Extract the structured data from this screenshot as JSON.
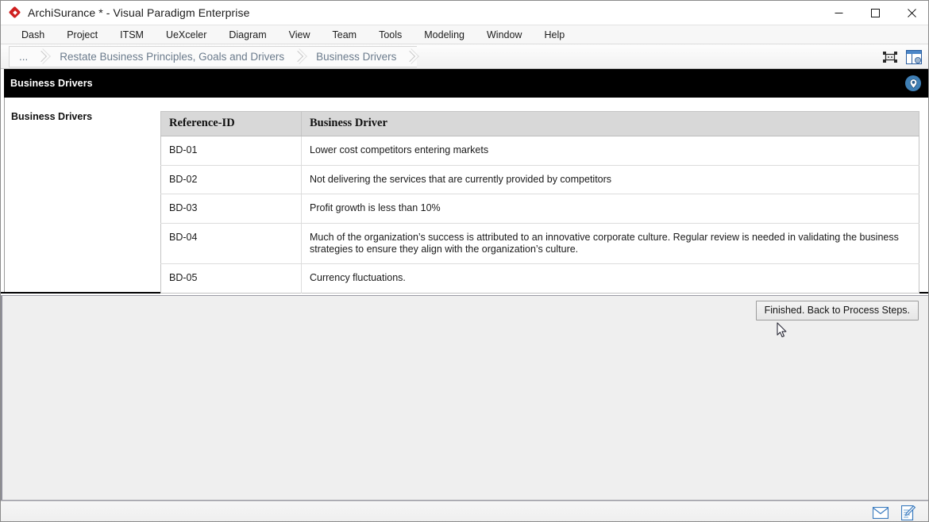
{
  "window": {
    "title": "ArchiSurance * - Visual Paradigm Enterprise",
    "logo_icon": "red-diamond-logo",
    "controls": {
      "minimize_label": "Minimize",
      "maximize_label": "Maximize",
      "close_label": "Close"
    }
  },
  "menubar": {
    "items": [
      {
        "label": "Dash"
      },
      {
        "label": "Project"
      },
      {
        "label": "ITSM"
      },
      {
        "label": "UeXceler"
      },
      {
        "label": "Diagram"
      },
      {
        "label": "View"
      },
      {
        "label": "Team"
      },
      {
        "label": "Tools"
      },
      {
        "label": "Modeling"
      },
      {
        "label": "Window"
      },
      {
        "label": "Help"
      }
    ]
  },
  "breadcrumb": {
    "items": [
      {
        "label": "..."
      },
      {
        "label": "Restate Business Principles, Goals and Drivers"
      },
      {
        "label": "Business Drivers"
      }
    ],
    "tools": [
      {
        "icon": "fit-to-screen-icon"
      },
      {
        "icon": "panel-layout-icon"
      }
    ]
  },
  "section": {
    "title": "Business Drivers",
    "badge_icon": "location-pin-icon",
    "badge_color": "#3f7fb5"
  },
  "sidebar": {
    "label": "Business Drivers"
  },
  "table": {
    "columns": [
      {
        "key": "ref",
        "label": "Reference-ID"
      },
      {
        "key": "driver",
        "label": "Business Driver"
      }
    ],
    "rows": [
      {
        "ref": "BD-01",
        "driver": "Lower cost competitors entering markets"
      },
      {
        "ref": "BD-02",
        "driver": "Not delivering the services that are currently provided by competitors"
      },
      {
        "ref": "BD-03",
        "driver": "Profit growth is less than 10%"
      },
      {
        "ref": "BD-04",
        "driver": "Much of the organization’s success is attributed to an innovative corporate culture. Regular review is needed in validating the business strategies to ensure they align with the organization’s culture."
      },
      {
        "ref": "BD-05",
        "driver": "Currency fluctuations."
      }
    ]
  },
  "lower_panel": {
    "finish_button_label": "Finished. Back to Process Steps."
  },
  "statusbar": {
    "icons": [
      {
        "icon": "envelope-icon"
      },
      {
        "icon": "note-edit-icon"
      }
    ]
  },
  "colors": {
    "section_header_bg": "#000000",
    "table_header_bg": "#d8d8d8",
    "accent_blue": "#3f7fb5",
    "breadcrumb_text": "#6b7b8c"
  }
}
